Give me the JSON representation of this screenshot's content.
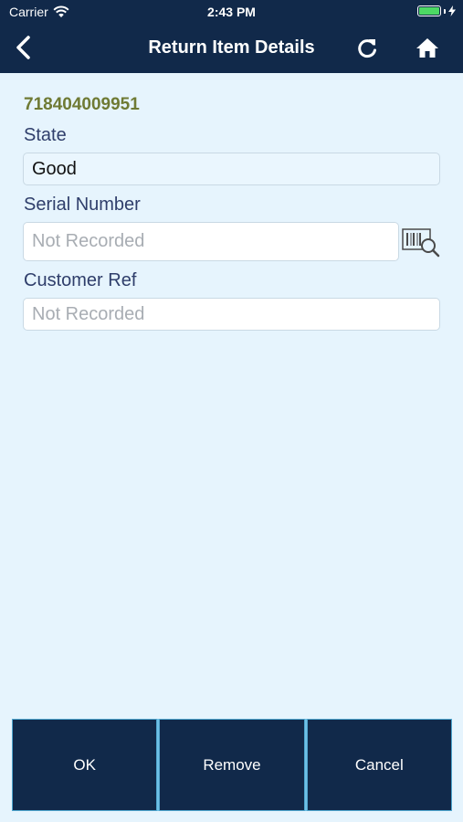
{
  "status_bar": {
    "carrier": "Carrier",
    "time": "2:43 PM",
    "wifi_icon": "wifi-icon",
    "battery_icon": "battery-icon",
    "battery_color": "#4cd964"
  },
  "header": {
    "title": "Return Item Details",
    "back_icon": "chevron-left-icon",
    "refresh_icon": "refresh-icon",
    "home_icon": "home-icon",
    "background": "#11294a"
  },
  "item": {
    "code": "718404009951",
    "code_color": "#6f7a34"
  },
  "form": {
    "state_label": "State",
    "state_value": "Good",
    "serial_label": "Serial Number",
    "serial_placeholder": "Not Recorded",
    "scan_icon": "barcode-search-icon",
    "customer_ref_label": "Customer Ref",
    "customer_ref_placeholder": "Not Recorded"
  },
  "footer": {
    "ok_label": "OK",
    "remove_label": "Remove",
    "cancel_label": "Cancel"
  }
}
